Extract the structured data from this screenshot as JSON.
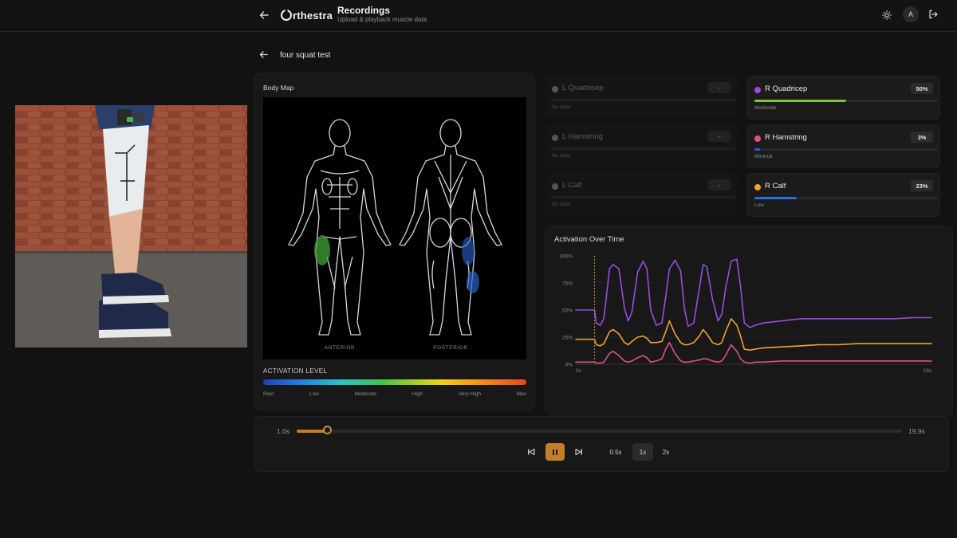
{
  "header": {
    "logo_text": "rthestra",
    "title": "Recordings",
    "subtitle": "Upload & playback muscle data",
    "avatar_initial": "A"
  },
  "recording": {
    "name": "four squat test"
  },
  "body_map": {
    "title": "Body Map",
    "anterior_label": "ANTERIOR",
    "posterior_label": "POSTERIOR",
    "activation_label": "ACTIVATION LEVEL",
    "levels": [
      "Rest",
      "Low",
      "Moderate",
      "High",
      "Very High",
      "Max"
    ]
  },
  "muscles": [
    {
      "name": "L Quadricep",
      "badge": "–",
      "status": "No data",
      "active": false,
      "color": "#555555",
      "level": 0
    },
    {
      "name": "R Quadricep",
      "badge": "50%",
      "status": "Moderate",
      "active": true,
      "color": "#9b4ce0",
      "bar_color": "#7fc23c",
      "level": 0.5
    },
    {
      "name": "L Hamstring",
      "badge": "–",
      "status": "No data",
      "active": false,
      "color": "#555555",
      "level": 0
    },
    {
      "name": "R Hamstring",
      "badge": "3%",
      "status": "Minimal",
      "active": true,
      "color": "#e0508a",
      "bar_color": "#2e5fd8",
      "level": 0.03
    },
    {
      "name": "L Calf",
      "badge": "–",
      "status": "No data",
      "active": false,
      "color": "#555555",
      "level": 0
    },
    {
      "name": "R Calf",
      "badge": "23%",
      "status": "Low",
      "active": true,
      "color": "#f0a232",
      "bar_color": "#2a6fe0",
      "level": 0.23
    }
  ],
  "chart_data": {
    "type": "line",
    "title": "Activation Over Time",
    "y_ticks": [
      "100%",
      "75%",
      "50%",
      "25%",
      "0%"
    ],
    "x_ticks": [
      "0s",
      "19s"
    ],
    "xlim": [
      0,
      19
    ],
    "ylim": [
      0,
      100
    ],
    "cursor_x": 1.0,
    "series": [
      {
        "color": "#9b4ce0",
        "x": [
          0,
          0.8,
          1.0,
          1.1,
          1.3,
          1.5,
          1.8,
          2.0,
          2.3,
          2.6,
          2.8,
          3.0,
          3.3,
          3.6,
          3.8,
          4.0,
          4.3,
          4.6,
          4.8,
          5.0,
          5.3,
          5.6,
          5.8,
          6.0,
          6.3,
          6.6,
          6.8,
          7.0,
          7.3,
          7.6,
          7.8,
          8.0,
          8.3,
          8.6,
          8.8,
          9.0,
          9.3,
          9.6,
          10,
          11,
          12,
          13,
          14,
          15,
          16,
          17,
          18,
          19
        ],
        "y": [
          50,
          50,
          50,
          38,
          36,
          42,
          88,
          92,
          88,
          52,
          40,
          48,
          85,
          95,
          88,
          50,
          36,
          38,
          62,
          88,
          96,
          86,
          52,
          35,
          38,
          70,
          92,
          90,
          60,
          40,
          46,
          70,
          95,
          97,
          72,
          38,
          34,
          36,
          38,
          40,
          42,
          42,
          42,
          42,
          42,
          42,
          43,
          43
        ]
      },
      {
        "color": "#f0a232",
        "x": [
          0,
          0.8,
          1.0,
          1.1,
          1.3,
          1.5,
          1.8,
          2.0,
          2.3,
          2.6,
          2.8,
          3.0,
          3.3,
          3.6,
          3.8,
          4.0,
          4.3,
          4.6,
          4.8,
          5.0,
          5.3,
          5.6,
          5.8,
          6.0,
          6.3,
          6.6,
          6.8,
          7.0,
          7.3,
          7.6,
          7.8,
          8.0,
          8.3,
          8.6,
          8.8,
          9.0,
          9.3,
          9.6,
          10,
          11,
          12,
          13,
          14,
          15,
          16,
          17,
          18,
          19
        ],
        "y": [
          23,
          23,
          23,
          18,
          17,
          19,
          30,
          32,
          28,
          20,
          18,
          21,
          25,
          26,
          24,
          20,
          20,
          21,
          30,
          40,
          28,
          20,
          18,
          18,
          20,
          26,
          32,
          28,
          20,
          18,
          20,
          30,
          42,
          36,
          26,
          14,
          13,
          14,
          15,
          16,
          17,
          18,
          18,
          19,
          19,
          19,
          19,
          19
        ]
      },
      {
        "color": "#e0508a",
        "x": [
          0,
          0.8,
          1.0,
          1.1,
          1.3,
          1.5,
          1.8,
          2.0,
          2.3,
          2.6,
          2.8,
          3.0,
          3.3,
          3.6,
          3.8,
          4.0,
          4.3,
          4.6,
          4.8,
          5.0,
          5.3,
          5.6,
          5.8,
          6.0,
          6.3,
          6.6,
          6.8,
          7.0,
          7.3,
          7.6,
          7.8,
          8.0,
          8.3,
          8.6,
          8.8,
          9.0,
          9.3,
          9.6,
          10,
          11,
          12,
          13,
          14,
          15,
          16,
          17,
          18,
          19
        ],
        "y": [
          2,
          2,
          2,
          1,
          1,
          2,
          10,
          12,
          8,
          3,
          2,
          3,
          6,
          8,
          6,
          2,
          3,
          5,
          14,
          20,
          10,
          3,
          2,
          2,
          3,
          4,
          5,
          5,
          3,
          2,
          3,
          8,
          18,
          12,
          5,
          2,
          1,
          2,
          2,
          3,
          3,
          3,
          3,
          3,
          3,
          3,
          3,
          3
        ]
      }
    ]
  },
  "playback": {
    "current": "1.0s",
    "total": "19.9s",
    "progress": 0.05,
    "speeds": [
      "0.5x",
      "1x",
      "2x"
    ],
    "selected_speed": "1x"
  }
}
